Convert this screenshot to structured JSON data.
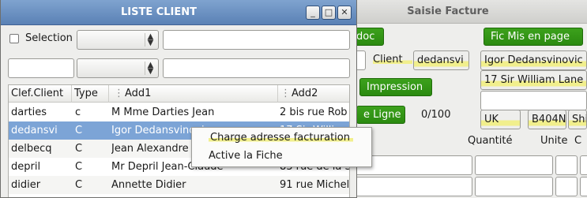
{
  "facture": {
    "title": "Saisie Facture",
    "btn_doc": "doc",
    "btn_fic_mis_en_page": "Fic Mis en page",
    "btn_impression": "Impression",
    "btn_ligne": "e Ligne",
    "client_label": "Client",
    "client_code": "dedansvi",
    "client_name": "Igor Dedansvinovic",
    "address_line": "17 Sir William Lane",
    "address_line2": "",
    "counter": "0/100",
    "country": "UK",
    "postcode": "B404N",
    "city": "Shi",
    "col_quantite": "Quantité",
    "col_unite": "Unite",
    "col_c": "C"
  },
  "liste": {
    "title": "LISTE CLIENT",
    "minimize": "_",
    "restore": "□",
    "close": "✕",
    "selection_label": "Selection",
    "selection_checked": false,
    "filter1_value": "",
    "filter2_value": "",
    "filter3_value": "",
    "filter4_value": "",
    "columns": [
      "Clef.Client",
      "Type",
      "Add1",
      "Add2"
    ],
    "rows": [
      {
        "clef": "darties",
        "type": "c",
        "add1": "M Mme Darties Jean",
        "add2": "2 bis rue Rob"
      },
      {
        "clef": "dedansvi",
        "type": "C",
        "add1": "Igor Dedansvinovic",
        "add2": "17 Sir William"
      },
      {
        "clef": "delbecq",
        "type": "C",
        "add1": "Jean Alexandre",
        "add2": ""
      },
      {
        "clef": "depril",
        "type": "C",
        "add1": "Mr Depril Jean-Claude",
        "add2": "83 rue de la S"
      },
      {
        "clef": "didier",
        "type": "C",
        "add1": "Annette Didier",
        "add2": "91 rue Michel"
      }
    ],
    "selected_row": 1
  },
  "context_menu": {
    "items": [
      "Charge adresse facturation",
      "Active la Fiche"
    ]
  },
  "colors": {
    "title_active": "#5a81b5",
    "selection": "#7ca4d6",
    "green_button": "#2b8a10",
    "highlight": "#f1ef8c"
  }
}
